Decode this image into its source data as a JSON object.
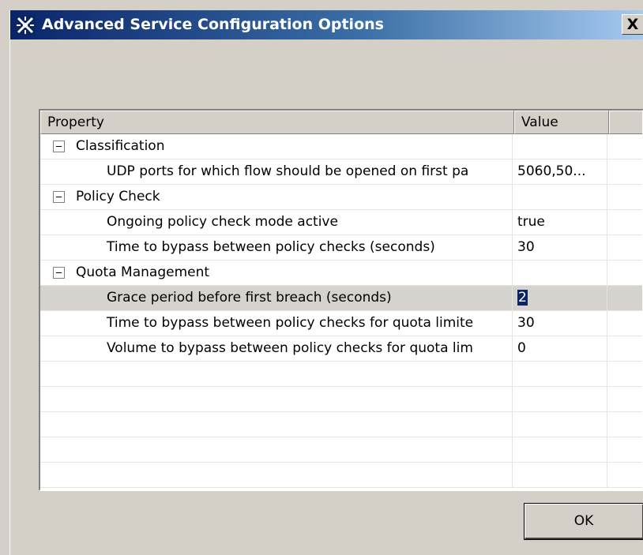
{
  "window": {
    "title": "Advanced Service Configuration Options",
    "close_label": "X",
    "app_icon": "plugin-icon"
  },
  "table": {
    "columns": [
      "Property",
      "Value",
      ""
    ],
    "rows": [
      {
        "kind": "group",
        "property": "Classification",
        "value": ""
      },
      {
        "kind": "item",
        "property": "UDP ports for which flow should be opened on first pa",
        "value": "5060,50..."
      },
      {
        "kind": "group",
        "property": "Policy Check",
        "value": ""
      },
      {
        "kind": "item",
        "property": "Ongoing policy check mode active",
        "value": "true"
      },
      {
        "kind": "item",
        "property": "Time to bypass between policy checks (seconds)",
        "value": "30"
      },
      {
        "kind": "group",
        "property": "Quota Management",
        "value": ""
      },
      {
        "kind": "item",
        "property": "Grace period before first breach (seconds)",
        "value": "2",
        "selected": true,
        "editing": true
      },
      {
        "kind": "item",
        "property": "Time to bypass between policy checks for quota limite",
        "value": "30"
      },
      {
        "kind": "item",
        "property": "Volume to bypass between policy checks for quota lim",
        "value": "0"
      },
      {
        "kind": "empty"
      },
      {
        "kind": "empty"
      },
      {
        "kind": "empty"
      },
      {
        "kind": "empty"
      },
      {
        "kind": "empty"
      }
    ]
  },
  "buttons": {
    "ok_label": "OK"
  },
  "colors": {
    "titlebar_start": "#0a246a",
    "titlebar_end": "#a6caf0",
    "dialog_bg": "#d4d0c8",
    "selection": "#0a246a"
  }
}
